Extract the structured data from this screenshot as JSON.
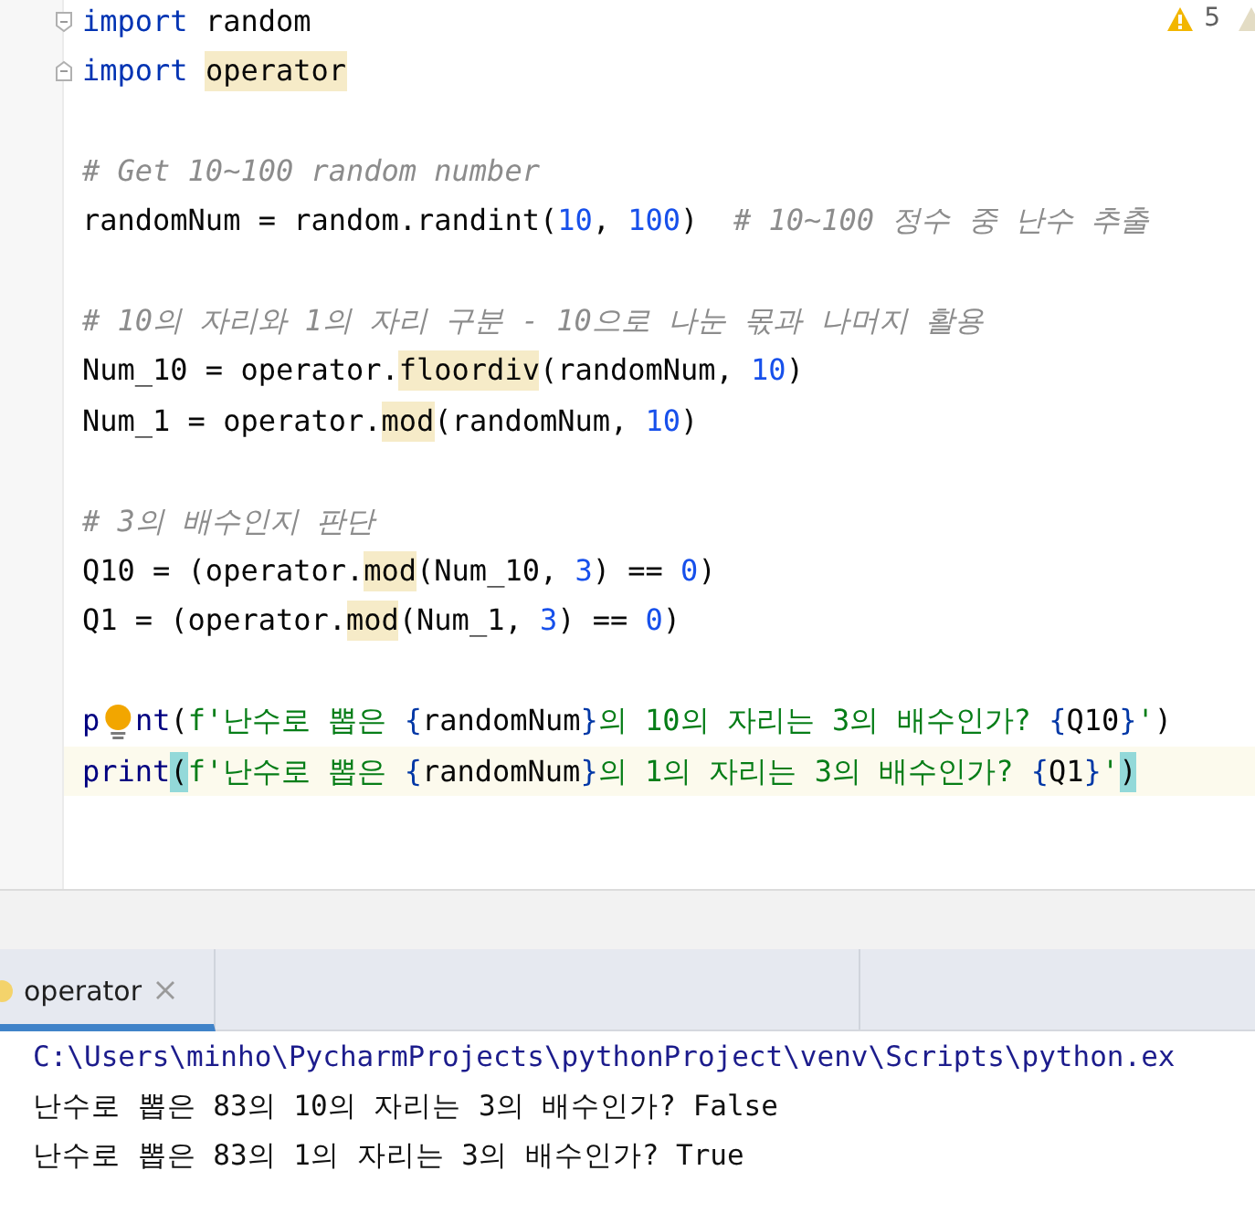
{
  "editor": {
    "inspections": {
      "count": "5"
    },
    "lines": [
      {
        "kind": "code",
        "current": false,
        "fold_start": true,
        "tokens": [
          {
            "t": "import",
            "kind": "kw"
          },
          {
            "t": " random",
            "kind": "plain"
          }
        ]
      },
      {
        "kind": "code",
        "current": false,
        "fold_end": true,
        "tokens": [
          {
            "t": "import ",
            "kind": "kw"
          },
          {
            "t": "operator",
            "kind": "plain",
            "usage_highlight": true
          }
        ]
      },
      {
        "kind": "blank",
        "current": false
      },
      {
        "kind": "code",
        "current": false,
        "tokens": [
          {
            "t": "# Get 10~100 random number",
            "kind": "cmt"
          }
        ]
      },
      {
        "kind": "code",
        "current": false,
        "tokens": [
          {
            "t": "randomNum = random.randint(",
            "kind": "plain"
          },
          {
            "t": "10",
            "kind": "num"
          },
          {
            "t": ", ",
            "kind": "plain"
          },
          {
            "t": "100",
            "kind": "num"
          },
          {
            "t": ")  ",
            "kind": "plain"
          },
          {
            "t": "# 10~100 정수 중 난수 추출",
            "kind": "cmt"
          }
        ]
      },
      {
        "kind": "blank",
        "current": false
      },
      {
        "kind": "code",
        "current": false,
        "tokens": [
          {
            "t": "# 10의 자리와 1의 자리 구분 - 10으로 나눈 몫과 나머지 활용",
            "kind": "cmt"
          }
        ]
      },
      {
        "kind": "code",
        "current": false,
        "tokens": [
          {
            "t": "Num_10 = operator.",
            "kind": "plain"
          },
          {
            "t": "floordiv",
            "kind": "plain",
            "usage_highlight": true
          },
          {
            "t": "(randomNum, ",
            "kind": "plain"
          },
          {
            "t": "10",
            "kind": "num"
          },
          {
            "t": ")",
            "kind": "plain"
          }
        ]
      },
      {
        "kind": "code",
        "current": false,
        "tokens": [
          {
            "t": "Num_1 = operator.",
            "kind": "plain"
          },
          {
            "t": "mod",
            "kind": "plain",
            "usage_highlight": true
          },
          {
            "t": "(randomNum, ",
            "kind": "plain"
          },
          {
            "t": "10",
            "kind": "num"
          },
          {
            "t": ")",
            "kind": "plain"
          }
        ]
      },
      {
        "kind": "blank",
        "current": false
      },
      {
        "kind": "code",
        "current": false,
        "tokens": [
          {
            "t": "# 3의 배수인지 판단",
            "kind": "cmt"
          }
        ]
      },
      {
        "kind": "code",
        "current": false,
        "tokens": [
          {
            "t": "Q10 = (operator.",
            "kind": "plain"
          },
          {
            "t": "mod",
            "kind": "plain",
            "usage_highlight": true
          },
          {
            "t": "(Num_10, ",
            "kind": "plain"
          },
          {
            "t": "3",
            "kind": "num"
          },
          {
            "t": ") == ",
            "kind": "plain"
          },
          {
            "t": "0",
            "kind": "num"
          },
          {
            "t": ")",
            "kind": "plain"
          }
        ]
      },
      {
        "kind": "code",
        "current": false,
        "tokens": [
          {
            "t": "Q1 = (operator.",
            "kind": "plain"
          },
          {
            "t": "mod",
            "kind": "plain",
            "usage_highlight": true
          },
          {
            "t": "(Num_1, ",
            "kind": "plain"
          },
          {
            "t": "3",
            "kind": "num"
          },
          {
            "t": ") == ",
            "kind": "plain"
          },
          {
            "t": "0",
            "kind": "num"
          },
          {
            "t": ")",
            "kind": "plain"
          }
        ]
      },
      {
        "kind": "blank",
        "current": false
      },
      {
        "kind": "code",
        "current": false,
        "tokens": [
          {
            "t": "p",
            "kind": "builtin"
          },
          {
            "kind": "bulb"
          },
          {
            "t": "nt",
            "kind": "builtin"
          },
          {
            "t": "(",
            "kind": "plain"
          },
          {
            "t": "f'난수로 뽑은 ",
            "kind": "str"
          },
          {
            "t": "{",
            "kind": "brace"
          },
          {
            "t": "randomNum",
            "kind": "plain"
          },
          {
            "t": "}",
            "kind": "brace"
          },
          {
            "t": "의 10의 자리는 3의 배수인가? ",
            "kind": "str"
          },
          {
            "t": "{",
            "kind": "brace"
          },
          {
            "t": "Q10",
            "kind": "plain"
          },
          {
            "t": "}",
            "kind": "brace"
          },
          {
            "t": "'",
            "kind": "str"
          },
          {
            "t": ")",
            "kind": "plain"
          }
        ]
      },
      {
        "kind": "code",
        "current": true,
        "tokens": [
          {
            "t": "print",
            "kind": "builtin"
          },
          {
            "t": "(",
            "kind": "plain",
            "brace_match": true
          },
          {
            "t": "f'난수로 뽑은 ",
            "kind": "str"
          },
          {
            "t": "{",
            "kind": "brace"
          },
          {
            "t": "randomNum",
            "kind": "plain"
          },
          {
            "t": "}",
            "kind": "brace"
          },
          {
            "t": "의 1의 자리는 3의 배수인가? ",
            "kind": "str"
          },
          {
            "t": "{",
            "kind": "brace"
          },
          {
            "t": "Q1",
            "kind": "plain"
          },
          {
            "t": "}",
            "kind": "brace"
          },
          {
            "t": "'",
            "kind": "str"
          },
          {
            "t": ")",
            "kind": "plain",
            "brace_match": true
          }
        ]
      }
    ]
  },
  "console": {
    "tabs": [
      {
        "label": "operator",
        "selected": true
      }
    ],
    "lines": [
      {
        "kind": "command",
        "text": "C:\\Users\\minho\\PycharmProjects\\pythonProject\\venv\\Scripts\\python.ex"
      },
      {
        "kind": "output",
        "text": "난수로 뽑은 83의 10의 자리는 3의 배수인가? False"
      },
      {
        "kind": "output",
        "text": "난수로 뽑은 83의 1의 자리는 3의 배수인가? True"
      }
    ]
  }
}
